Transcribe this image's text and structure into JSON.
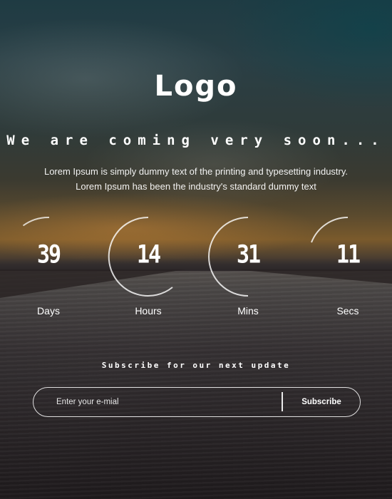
{
  "brand": {
    "logo_text": "Logo"
  },
  "headline": "We are coming very soon...",
  "lead_lines": [
    "Lorem Ipsum is simply dummy text of the printing and typesetting industry.",
    "Lorem Ipsum has been the industry's standard dummy text"
  ],
  "countdown": [
    {
      "value": "39",
      "label": "Days"
    },
    {
      "value": "14",
      "label": "Hours"
    },
    {
      "value": "31",
      "label": "Mins"
    },
    {
      "value": "11",
      "label": "Secs"
    }
  ],
  "subscribe": {
    "title": "Subscribe for our next update",
    "email_placeholder": "Enter your e-mial",
    "email_value": "",
    "button_label": "Subscribe"
  },
  "colors": {
    "text": "#ffffff",
    "accent_outline": "#ffffff"
  }
}
